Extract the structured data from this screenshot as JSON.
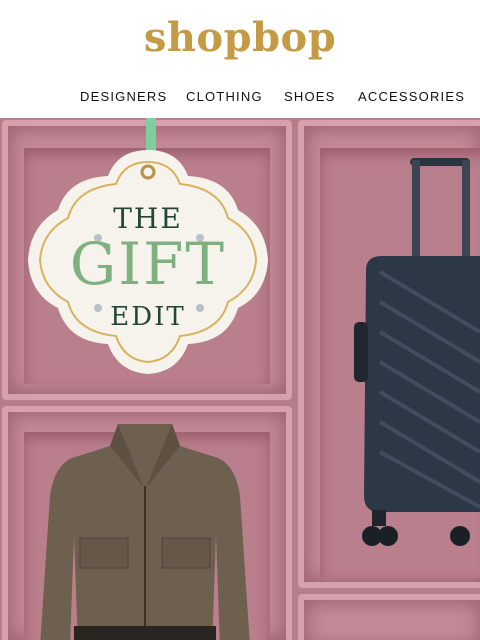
{
  "brand": {
    "logo_text": "shopbop"
  },
  "nav": {
    "items": [
      {
        "label": "DESIGNERS"
      },
      {
        "label": "CLOTHING"
      },
      {
        "label": "SHOES"
      },
      {
        "label": "ACCESSORIES"
      }
    ]
  },
  "hero": {
    "tag_line1": "THE",
    "tag_line2": "GIFT",
    "tag_line3": "EDIT",
    "colors": {
      "background": "#b67d8a",
      "tag_green": "#7fb07f",
      "tag_dark": "#234636",
      "gold": "#c59a45"
    }
  }
}
